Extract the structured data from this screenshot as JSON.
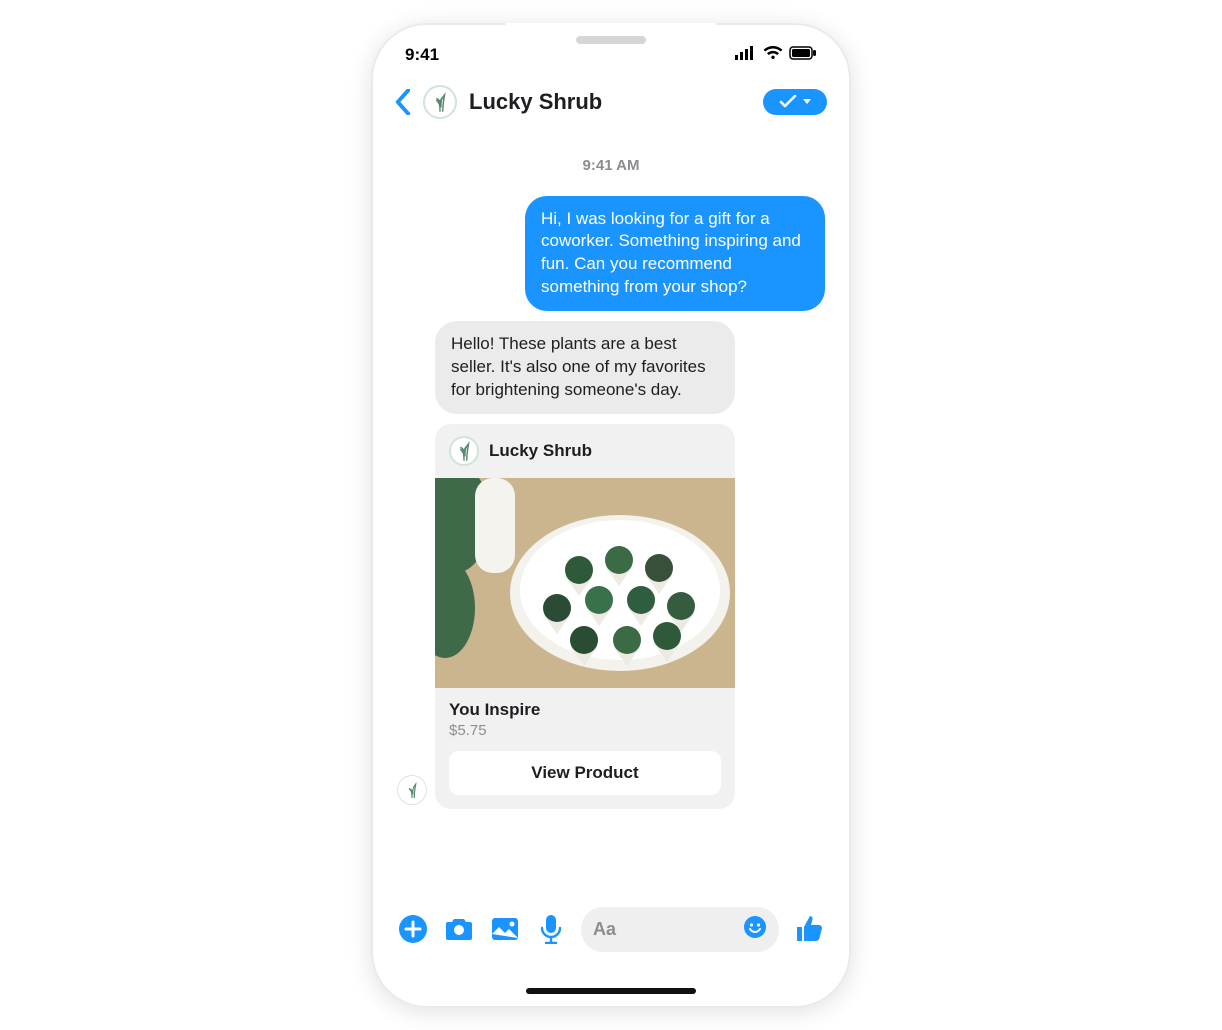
{
  "status_bar": {
    "time": "9:41"
  },
  "header": {
    "title": "Lucky Shrub",
    "sender_name": "Lucky Shrub"
  },
  "thread": {
    "timestamp": "9:41 AM",
    "user_msg": "Hi, I was looking for a gift for a coworker. Something inspiring and fun. Can you recommend something from your shop?",
    "bot_msg": "Hello! These plants are a best seller. It's also one of my favorites for brightening someone's day."
  },
  "product": {
    "merchant": "Lucky Shrub",
    "title": "You Inspire",
    "price": "$5.75",
    "cta_label": "View Product"
  },
  "composer": {
    "placeholder": "Aa"
  }
}
